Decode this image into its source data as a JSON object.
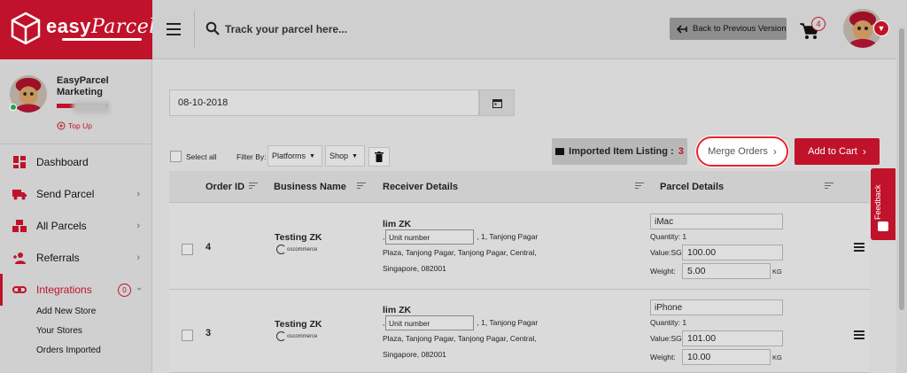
{
  "brand": {
    "logo_text": "easy",
    "logo_text_italic": "Parcel"
  },
  "header": {
    "search_placeholder": "Track your parcel here...",
    "back_button": "Back to Previous Version",
    "cart_count": "4"
  },
  "sidebar": {
    "profile_name": "EasyParcel Marketing",
    "topup_label": "Top Up",
    "items": [
      {
        "label": "Dashboard"
      },
      {
        "label": "Send Parcel"
      },
      {
        "label": "All Parcels"
      },
      {
        "label": "Referrals"
      },
      {
        "label": "Integrations",
        "badge": "0"
      }
    ],
    "sub_items": [
      "Add New Store",
      "Your Stores",
      "Orders Imported"
    ]
  },
  "main": {
    "date_value": "08-10-2018",
    "select_all": "Select all",
    "filter_by": "Filter By:",
    "filter_platforms": "Platforms",
    "filter_shop": "Shop",
    "imported_label": "Imported Item Listing :",
    "imported_count": "3",
    "merge_button": "Merge Orders",
    "add_cart_button": "Add to Cart",
    "columns": [
      "Order ID",
      "Business Name",
      "Receiver Details",
      "Parcel Details"
    ],
    "rows": [
      {
        "order_id": "4",
        "business": "Testing ZK",
        "platform": "oscommerce",
        "receiver_name": "lim ZK",
        "unit_placeholder": "Unit number",
        "addr_prefix": ",",
        "addr_suffix": ", 1, Tanjong Pagar",
        "addr_line2": "Plaza, Tanjong Pagar, Tanjong Pagar, Central,",
        "addr_line3": "Singapore, 082001",
        "item": "iMac",
        "quantity": "Quantity: 1",
        "value_label": "Value:SGD",
        "value": "100.00",
        "weight_label": "Weight:",
        "weight": "5.00",
        "unit": "KG"
      },
      {
        "order_id": "3",
        "business": "Testing ZK",
        "platform": "oscommerce",
        "receiver_name": "lim ZK",
        "unit_placeholder": "Unit number",
        "addr_prefix": ",",
        "addr_suffix": ", 1, Tanjong Pagar",
        "addr_line2": "Plaza, Tanjong Pagar, Tanjong Pagar, Central,",
        "addr_line3": "Singapore, 082001",
        "item": "iPhone",
        "quantity": "Quantity: 1",
        "value_label": "Value:SGD",
        "value": "101.00",
        "weight_label": "Weight:",
        "weight": "10.00",
        "unit": "KG"
      }
    ]
  },
  "feedback": {
    "label": "Feedback"
  },
  "colors": {
    "accent": "#c0122a",
    "highlight": "#e8232b"
  }
}
